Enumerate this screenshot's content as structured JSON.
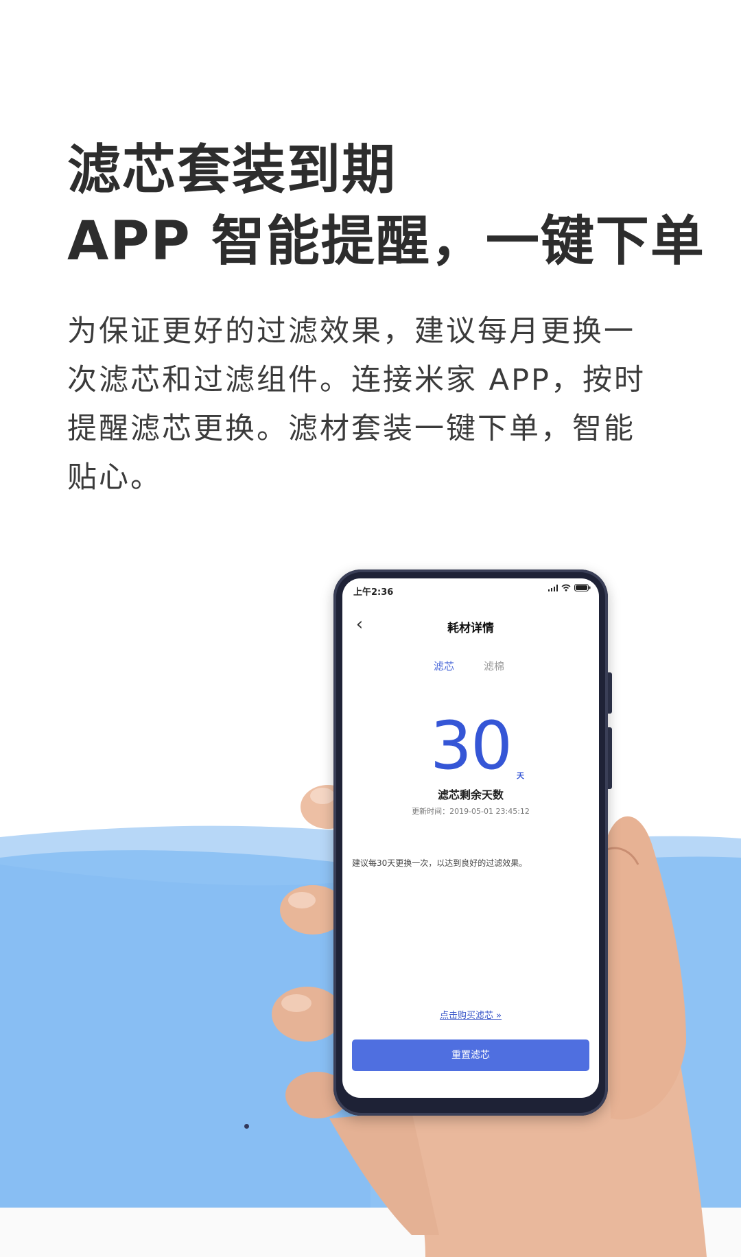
{
  "headline": {
    "line1": "滤芯套装到期",
    "line2": "APP  智能提醒，一键下单"
  },
  "body": {
    "lines": [
      "为保证更好的过滤效果，建议每月更换一",
      "次滤芯和过滤组件。连接米家 APP，按时",
      "提醒滤芯更换。滤材套装一键下单，智能",
      "贴心。"
    ]
  },
  "phone": {
    "status": {
      "time": "上午2:36",
      "icons": [
        "signal-icon",
        "wifi-icon",
        "battery-icon"
      ]
    },
    "nav": {
      "back_icon": "chevron-left-icon",
      "title": "耗材详情"
    },
    "tabs": [
      {
        "label": "滤芯",
        "active": true
      },
      {
        "label": "滤棉",
        "active": false
      }
    ],
    "remaining": {
      "days": "30",
      "unit": "天",
      "label": "滤芯剩余天数",
      "updated": "更新时间：2019-05-01  23:45:12"
    },
    "advice": "建议每30天更换一次，以达到良好的过滤效果。",
    "buy_link": "点击购买滤芯 »",
    "reset_button": "重置滤芯"
  },
  "colors": {
    "accent": "#3556d6",
    "button": "#4f6fe0",
    "wave_light": "#a9cdf5",
    "wave_main": "#87bdf3"
  }
}
